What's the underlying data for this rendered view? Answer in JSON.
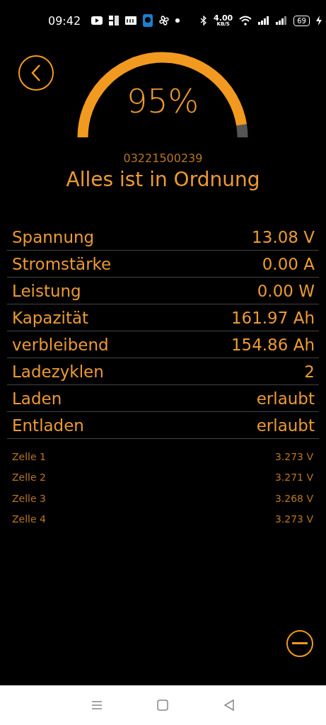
{
  "status_bar": {
    "time": "09:42",
    "net_speed": "4.00",
    "net_unit": "KB/S",
    "battery": "69"
  },
  "gauge": {
    "reading": "95%"
  },
  "serial": "03221500239",
  "status": "Alles ist in Ordnung",
  "values": [
    {
      "label": "Spannung",
      "value": "13.08 V"
    },
    {
      "label": "Stromstärke",
      "value": "0.00 A"
    },
    {
      "label": "Leistung",
      "value": "0.00 W"
    },
    {
      "label": "Kapazität",
      "value": "161.97 Ah"
    },
    {
      "label": "verbleibend",
      "value": "154.86 Ah"
    },
    {
      "label": "Ladezyklen",
      "value": "2"
    },
    {
      "label": "Laden",
      "value": "erlaubt"
    },
    {
      "label": "Entladen",
      "value": "erlaubt"
    }
  ],
  "cells": [
    {
      "label": "Zelle 1",
      "value": "3.273 V"
    },
    {
      "label": "Zelle 2",
      "value": "3.271 V"
    },
    {
      "label": "Zelle 3",
      "value": "3.268 V"
    },
    {
      "label": "Zelle 4",
      "value": "3.273 V"
    }
  ]
}
